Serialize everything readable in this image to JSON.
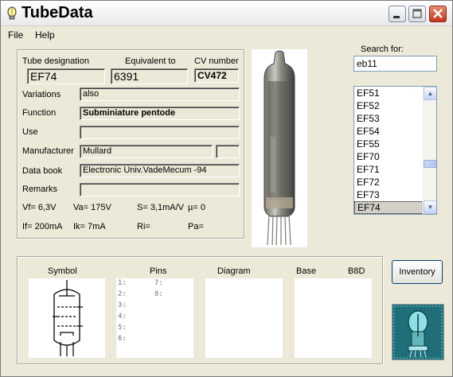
{
  "window": {
    "title": "TubeData"
  },
  "menu": {
    "file": "File",
    "help": "Help"
  },
  "search": {
    "label": "Search for:",
    "value": "eb11"
  },
  "tube_list": {
    "items": [
      "EF51",
      "EF52",
      "EF53",
      "EF54",
      "EF55",
      "EF70",
      "EF71",
      "EF72",
      "EF73",
      "EF74"
    ],
    "selected": "EF74"
  },
  "details": {
    "designation_label": "Tube designation",
    "designation_value": "EF74",
    "equivalent_label": "Equivalent to",
    "equivalent_value": "6391",
    "cv_label": "CV number",
    "cv_value": "CV472",
    "variations_label": "Variations",
    "variations_value": "also",
    "function_label": "Function",
    "function_value": "Subminiature pentode",
    "use_label": "Use",
    "use_value": "",
    "manufacturer_label": "Manufacturer",
    "manufacturer_value": "Mullard",
    "manufacturer_extra": "",
    "databook_label": "Data book",
    "databook_value": "Electronic Univ.VadeMecum -94",
    "remarks_label": "Remarks",
    "remarks_value": ""
  },
  "specs": {
    "vf": "Vf= 6,3V",
    "va": "Va= 175V",
    "s": "S= 3,1mA/V",
    "mu": "µ=   0",
    "if": "If= 200mA",
    "ik": "Ik=  7mA",
    "ri": "Ri=",
    "pa": "Pa="
  },
  "bottom": {
    "symbol_label": "Symbol",
    "pins_label": "Pins",
    "diagram_label": "Diagram",
    "base_label": "Base",
    "base_value": "B8D",
    "pins_left": [
      "1:",
      "2:",
      "3:",
      "4:",
      "5:",
      "6:"
    ],
    "pins_right": [
      "7:",
      "8:"
    ],
    "inventory_button": "Inventory"
  },
  "colors": {
    "face": "#ECE9D8",
    "selection": "#d4d0c8",
    "logo_bg": "#1f6f7a"
  }
}
